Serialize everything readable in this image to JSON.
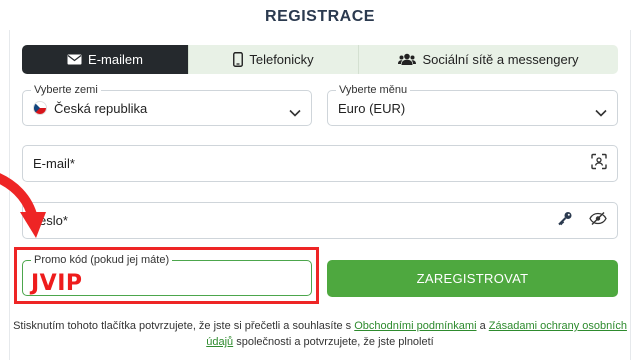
{
  "title": "REGISTRACE",
  "tabs": [
    {
      "label": "E-mailem",
      "icon": "envelope-icon",
      "active": true
    },
    {
      "label": "Telefonicky",
      "icon": "phone-icon",
      "active": false
    },
    {
      "label": "Sociální sítě a messengery",
      "icon": "users-icon",
      "active": false
    }
  ],
  "country": {
    "legend": "Vyberte zemi",
    "value": "Česká republika",
    "icon": "czech-flag-icon"
  },
  "currency": {
    "legend": "Vyberte měnu",
    "value": "Euro (EUR)"
  },
  "email": {
    "label": "E-mail*"
  },
  "password": {
    "label": "eslo*"
  },
  "promo": {
    "legend": "Promo kód (pokud jej máte)",
    "value": "JVIP"
  },
  "submit": {
    "label": "ZAREGISTROVAT"
  },
  "terms": {
    "prefix": "Stisknutím tohoto tlačítka potvrzujete, že jste si přečetli a souhlasíte s ",
    "link1": "Obchodními podmínkami",
    "middle": " a ",
    "link2a": "Zásadami ochrany osobních",
    "link2b": "údajů",
    "suffix": " společnosti a potvrzujete, že jste plnoletí"
  },
  "colors": {
    "accent_green": "#4ea83f",
    "highlight_red": "#ee2525",
    "tab_active": "#25292d"
  }
}
